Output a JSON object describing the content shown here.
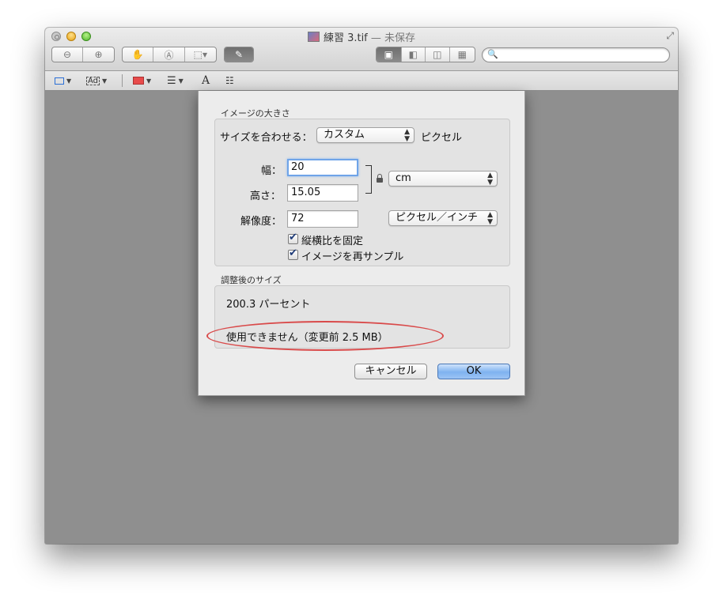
{
  "window": {
    "title_name": "練習 3.tif",
    "title_status": "— 未保存"
  },
  "toolbar": {
    "icons": [
      "zoom-out-icon",
      "zoom-in-icon",
      "hand-icon",
      "text-select-icon",
      "rect-select-icon",
      "pen-icon",
      "view-single-icon",
      "view-sidebar-icon",
      "view-split-icon",
      "view-grid-icon",
      "search-icon"
    ]
  },
  "dialog": {
    "image_size_section": "イメージの大きさ",
    "fit_label": "サイズを合わせる：",
    "fit_value": "カスタム",
    "fit_unit": "ピクセル",
    "width_label": "幅：",
    "width_value": "20",
    "height_label": "高さ：",
    "height_value": "15.05",
    "unit_value": "cm",
    "resolution_label": "解像度：",
    "resolution_value": "72",
    "resolution_unit": "ピクセル／インチ",
    "keep_ratio_label": "縦横比を固定",
    "keep_ratio_checked": true,
    "resample_label": "イメージを再サンプル",
    "resample_checked": true,
    "result_section": "調整後のサイズ",
    "result_percent": "200.3 パーセント",
    "result_size": "使用できません（変更前 2.5 MB）",
    "cancel_label": "キャンセル",
    "ok_label": "OK"
  },
  "colors": {
    "annotation_ellipse": "#d94a4a",
    "default_button": "#7fb2f0",
    "shape_stroke": "#2a6fd6",
    "fill_color": "#e84b4b"
  }
}
